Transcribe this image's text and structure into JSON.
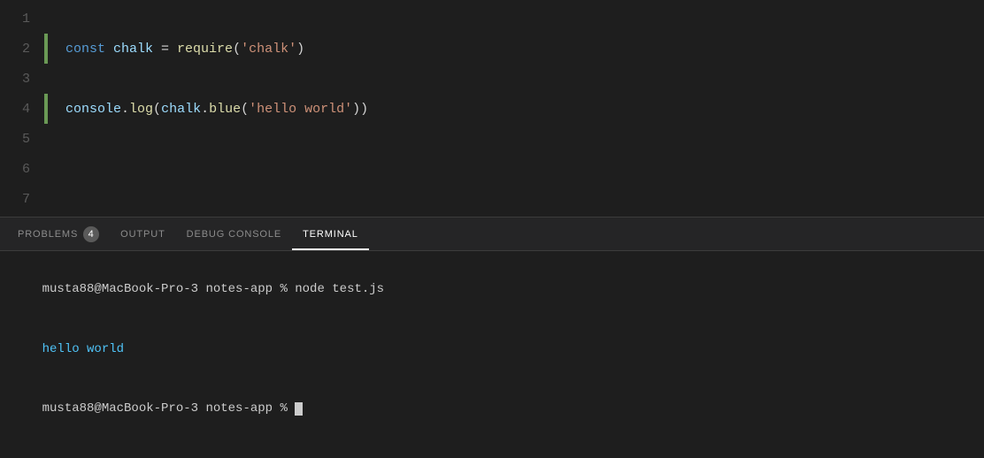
{
  "editor": {
    "lines": [
      {
        "number": "1",
        "active": false,
        "content": []
      },
      {
        "number": "2",
        "active": true,
        "content": [
          {
            "type": "kw-const",
            "text": "const "
          },
          {
            "type": "kw-var",
            "text": "chalk"
          },
          {
            "type": "plain",
            "text": " = "
          },
          {
            "type": "kw-fn",
            "text": "require"
          },
          {
            "type": "plain",
            "text": "("
          },
          {
            "type": "kw-str",
            "text": "'chalk'"
          },
          {
            "type": "plain",
            "text": ")"
          }
        ]
      },
      {
        "number": "3",
        "active": false,
        "content": []
      },
      {
        "number": "4",
        "active": true,
        "content": [
          {
            "type": "kw-prop",
            "text": "console"
          },
          {
            "type": "plain",
            "text": "."
          },
          {
            "type": "kw-method",
            "text": "log"
          },
          {
            "type": "plain",
            "text": "("
          },
          {
            "type": "kw-prop",
            "text": "chalk"
          },
          {
            "type": "plain",
            "text": "."
          },
          {
            "type": "kw-method",
            "text": "blue"
          },
          {
            "type": "plain",
            "text": "("
          },
          {
            "type": "kw-str",
            "text": "'hello world'"
          },
          {
            "type": "plain",
            "text": "))"
          }
        ]
      },
      {
        "number": "5",
        "active": false,
        "content": []
      },
      {
        "number": "6",
        "active": false,
        "content": []
      },
      {
        "number": "7",
        "active": false,
        "content": []
      }
    ]
  },
  "panel": {
    "tabs": [
      {
        "id": "problems",
        "label": "PROBLEMS",
        "badge": "4",
        "active": false
      },
      {
        "id": "output",
        "label": "OUTPUT",
        "active": false
      },
      {
        "id": "debug-console",
        "label": "DEBUG CONSOLE",
        "active": false
      },
      {
        "id": "terminal",
        "label": "TERMINAL",
        "active": true
      }
    ]
  },
  "terminal": {
    "line1": "musta88@MacBook-Pro-3 notes-app % node test.js",
    "line2": "hello world",
    "line3_prefix": "musta88@MacBook-Pro-3 notes-app % "
  }
}
